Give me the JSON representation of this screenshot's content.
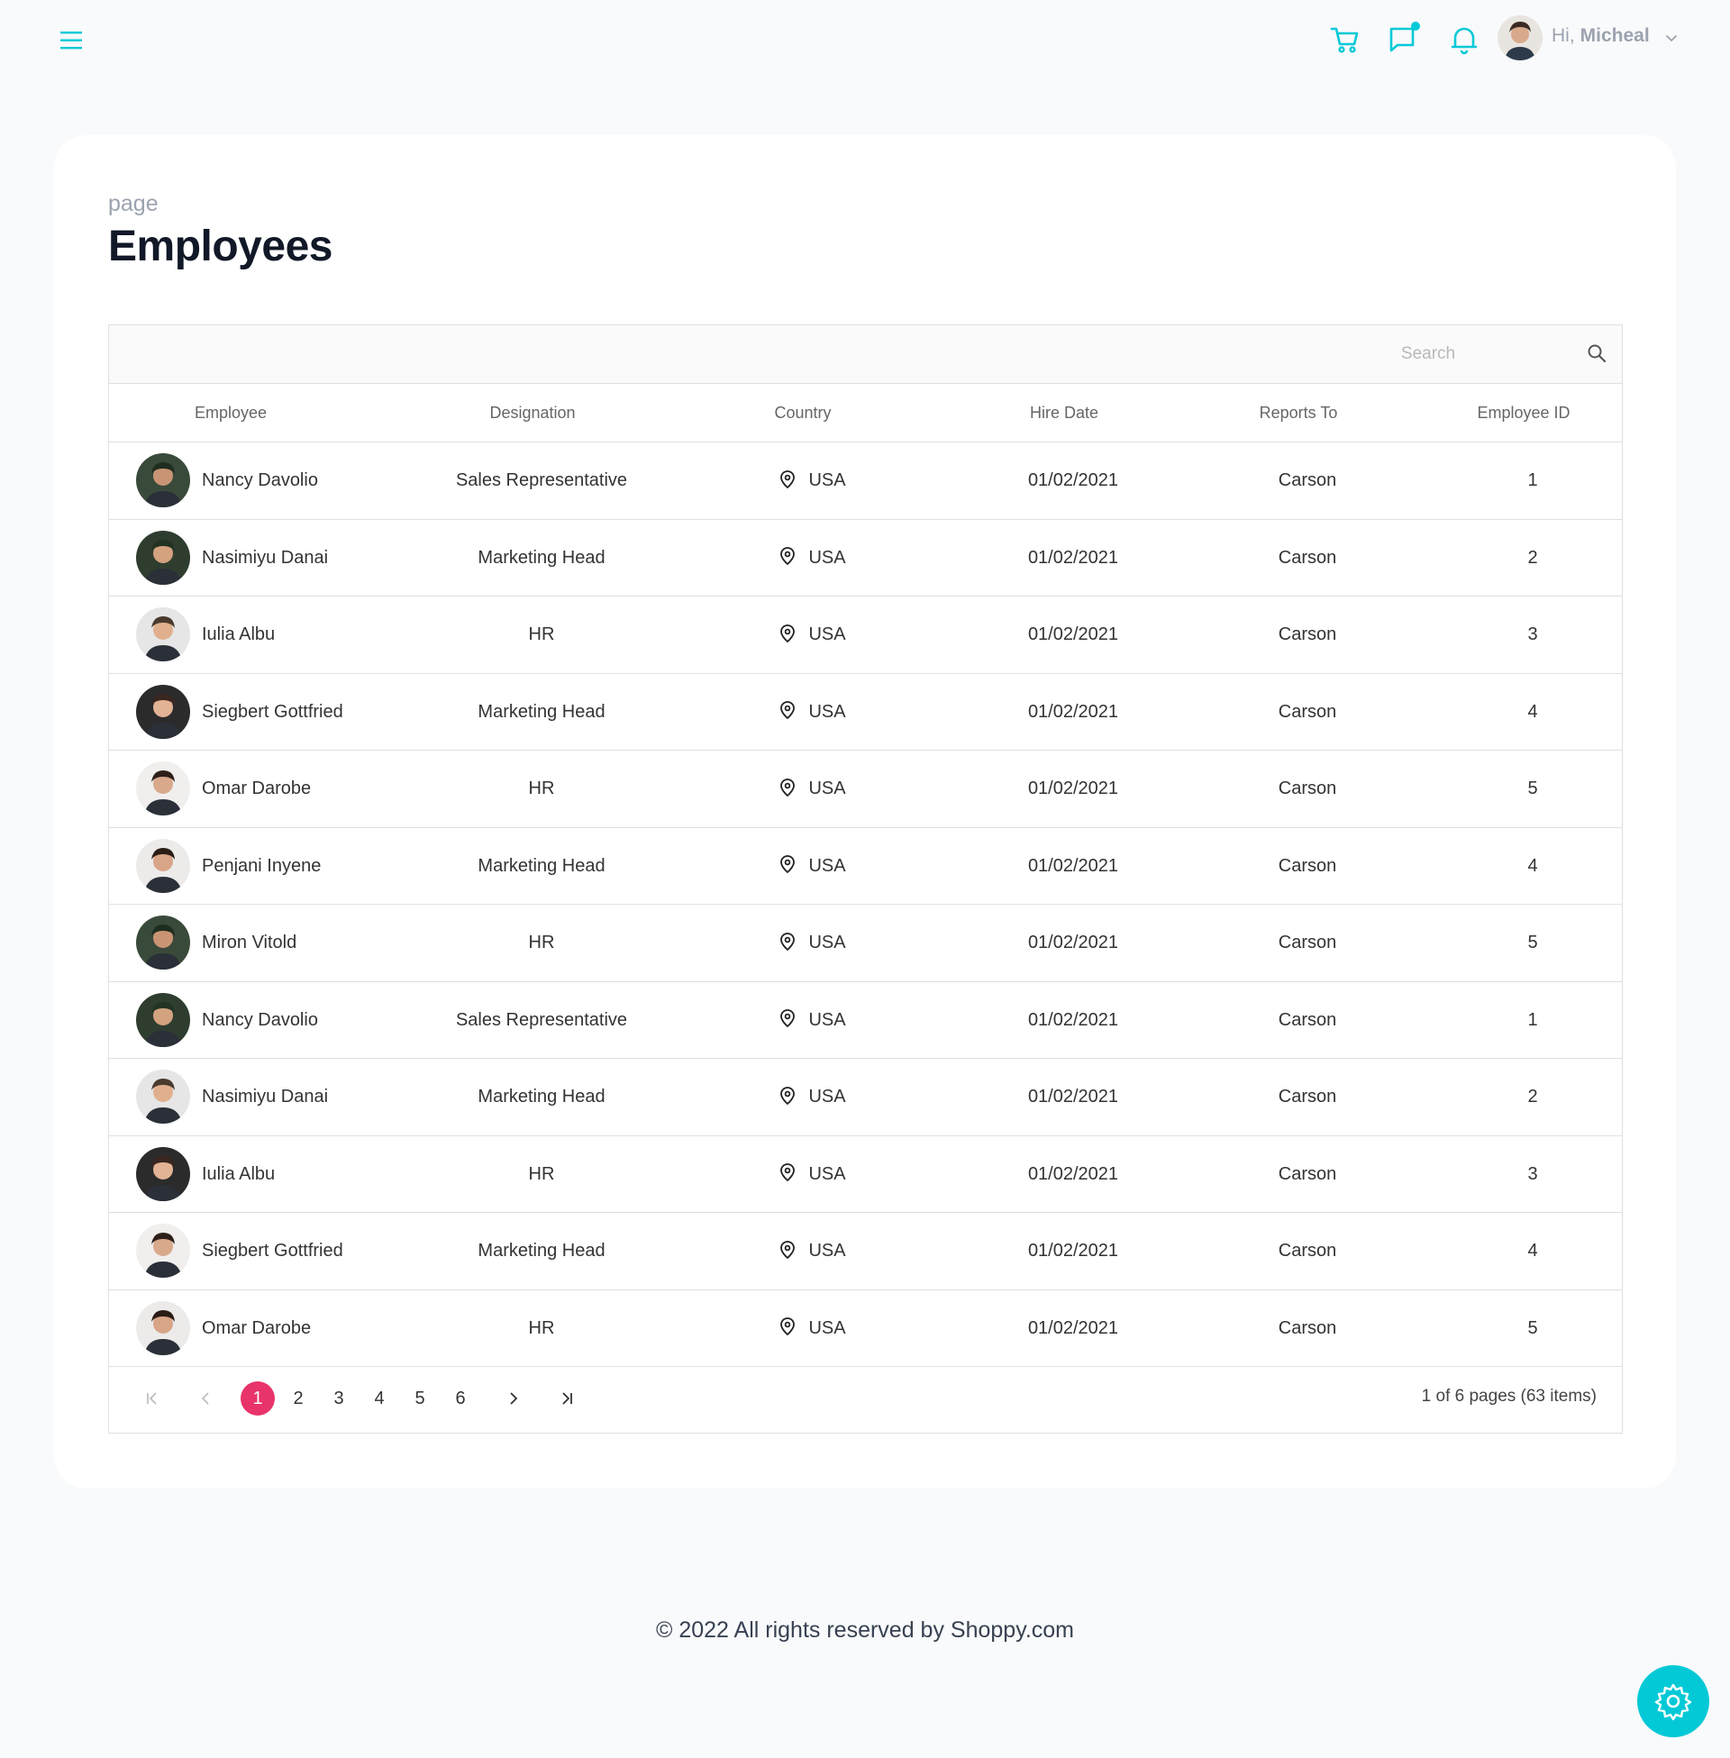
{
  "colors": {
    "accent": "#03c9d7",
    "page_active": "#e8336b",
    "title": "#111827"
  },
  "navbar": {
    "menu_icon": "hamburger-icon",
    "icons": [
      "cart-icon",
      "chat-icon",
      "bell-icon"
    ],
    "greeting": "Hi,",
    "user_name": "Micheal"
  },
  "page": {
    "breadcrumb": "page",
    "title": "Employees"
  },
  "search": {
    "placeholder": "Search"
  },
  "table": {
    "columns": [
      "Employee",
      "Designation",
      "Country",
      "Hire Date",
      "Reports To",
      "Employee ID"
    ],
    "rows": [
      {
        "name": "Nancy Davolio",
        "designation": "Sales Representative",
        "country": "USA",
        "hire_date": "01/02/2021",
        "reports_to": "Carson",
        "id": "1"
      },
      {
        "name": "Nasimiyu Danai",
        "designation": "Marketing Head",
        "country": "USA",
        "hire_date": "01/02/2021",
        "reports_to": "Carson",
        "id": "2"
      },
      {
        "name": "Iulia Albu",
        "designation": "HR",
        "country": "USA",
        "hire_date": "01/02/2021",
        "reports_to": "Carson",
        "id": "3"
      },
      {
        "name": "Siegbert Gottfried",
        "designation": "Marketing Head",
        "country": "USA",
        "hire_date": "01/02/2021",
        "reports_to": "Carson",
        "id": "4"
      },
      {
        "name": "Omar Darobe",
        "designation": "HR",
        "country": "USA",
        "hire_date": "01/02/2021",
        "reports_to": "Carson",
        "id": "5"
      },
      {
        "name": "Penjani Inyene",
        "designation": "Marketing Head",
        "country": "USA",
        "hire_date": "01/02/2021",
        "reports_to": "Carson",
        "id": "4"
      },
      {
        "name": "Miron Vitold",
        "designation": "HR",
        "country": "USA",
        "hire_date": "01/02/2021",
        "reports_to": "Carson",
        "id": "5"
      },
      {
        "name": "Nancy Davolio",
        "designation": "Sales Representative",
        "country": "USA",
        "hire_date": "01/02/2021",
        "reports_to": "Carson",
        "id": "1"
      },
      {
        "name": "Nasimiyu Danai",
        "designation": "Marketing Head",
        "country": "USA",
        "hire_date": "01/02/2021",
        "reports_to": "Carson",
        "id": "2"
      },
      {
        "name": "Iulia Albu",
        "designation": "HR",
        "country": "USA",
        "hire_date": "01/02/2021",
        "reports_to": "Carson",
        "id": "3"
      },
      {
        "name": "Siegbert Gottfried",
        "designation": "Marketing Head",
        "country": "USA",
        "hire_date": "01/02/2021",
        "reports_to": "Carson",
        "id": "4"
      },
      {
        "name": "Omar Darobe",
        "designation": "HR",
        "country": "USA",
        "hire_date": "01/02/2021",
        "reports_to": "Carson",
        "id": "5"
      }
    ]
  },
  "pager": {
    "pages": [
      "1",
      "2",
      "3",
      "4",
      "5",
      "6"
    ],
    "current": "1",
    "info": "1 of 6 pages (63 items)"
  },
  "footer": {
    "text": "© 2022 All rights reserved by Shoppy.com"
  }
}
